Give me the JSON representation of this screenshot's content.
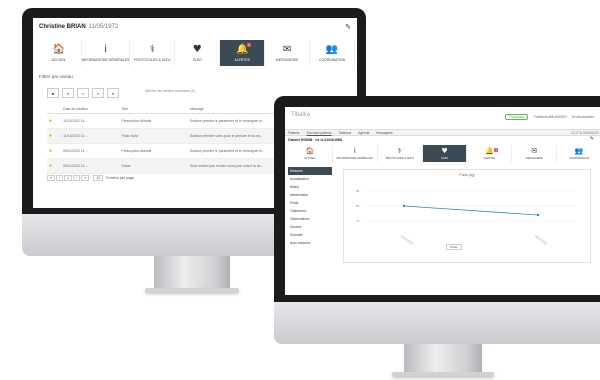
{
  "screen1": {
    "title": "Christine BRIAN",
    "subtitle": "11/05/1972",
    "tabs": [
      {
        "label": "Accueil",
        "icon": "home-icon",
        "glyph": "🏠"
      },
      {
        "label": "Informations générales",
        "icon": "info-icon",
        "glyph": "i"
      },
      {
        "label": "Protocoles & Suivi",
        "icon": "stethoscope-icon",
        "glyph": "⚕"
      },
      {
        "label": "Suivi",
        "icon": "heart-icon",
        "glyph": "♥"
      },
      {
        "label": "Alertes",
        "icon": "bell-icon",
        "glyph": "🔔",
        "badge": "1"
      },
      {
        "label": "Messagerie",
        "icon": "chat-icon",
        "glyph": "✉"
      },
      {
        "label": "Coordination",
        "icon": "team-icon",
        "glyph": "👥"
      }
    ],
    "filter_label": "Filtrer par niveau",
    "chips": [
      "■",
      "●",
      "●",
      "●",
      "●"
    ],
    "note": "Afficher les alertes archivées (1)",
    "table": {
      "headers": [
        "",
        "Date de création",
        "Titre",
        "Message"
      ],
      "rows": [
        [
          "●",
          "11/11/2022 11:...",
          "Prescription Aldosté",
          "Surface prendre le paramètre et le renseigner le..."
        ],
        [
          "●",
          "11/11/2022 11:...",
          "Poids Suivi",
          "Surface prendre soins pour le prendre le la ora..."
        ],
        [
          "●",
          "06/11/2022 11:...",
          "Prescription Aldosté",
          "Surface prendre le paramètre et le renseigner le..."
        ],
        [
          "●",
          "06/11/2022 11:...",
          "Suivie",
          "Suivi rendez pas rendez-vous pour suivre la do..."
        ]
      ]
    },
    "pagination": [
      "«",
      "‹",
      "1",
      "›",
      "»"
    ],
    "per_page": "10",
    "per_page_label": "Entrées par page"
  },
  "screen2": {
    "logo": "Tibalka",
    "top_pill": "Prestataire",
    "top_user": "Fabienne AMUNDSEN",
    "top_menu": "Se déconnecter",
    "nav": [
      "Patients",
      "Suivi des patients",
      "Tableaux",
      "Agenda",
      "Messagerie"
    ],
    "nav_right": "11:27 le 05/06/2022",
    "who": "Gabriel ROBIN · né le 01/04/1968",
    "tabs": [
      {
        "label": "Accueil",
        "icon": "home-icon",
        "glyph": "🏠"
      },
      {
        "label": "Informations générales",
        "icon": "info-icon",
        "glyph": "i"
      },
      {
        "label": "Protocoles & Suivi",
        "icon": "stethoscope-icon",
        "glyph": "⚕"
      },
      {
        "label": "Suivi",
        "icon": "heart-icon",
        "glyph": "♥",
        "active": true
      },
      {
        "label": "Alertes",
        "icon": "bell-icon",
        "glyph": "🔔",
        "badge": "1"
      },
      {
        "label": "Messagerie",
        "icon": "chat-icon",
        "glyph": "✉"
      },
      {
        "label": "Coordination",
        "icon": "team-icon",
        "glyph": "👥"
      }
    ],
    "side": [
      "Mesures",
      "Actualisation",
      "Bilans",
      "Alimentation",
      "Poids",
      "Traitement",
      "Observations",
      "Douleur",
      "Sommeil",
      "Auto-mesures"
    ],
    "chart_title": "Poids (kg)"
  },
  "chart_data": {
    "type": "line",
    "title": "Poids (kg)",
    "x": [
      "11/11/2022",
      "16/11/2022"
    ],
    "series": [
      {
        "name": "Poids",
        "values": [
          80,
          77
        ]
      }
    ],
    "yticks": [
      "85",
      "80",
      "75"
    ],
    "ylim": [
      72,
      88
    ],
    "grid": true,
    "legend": "bottom"
  }
}
